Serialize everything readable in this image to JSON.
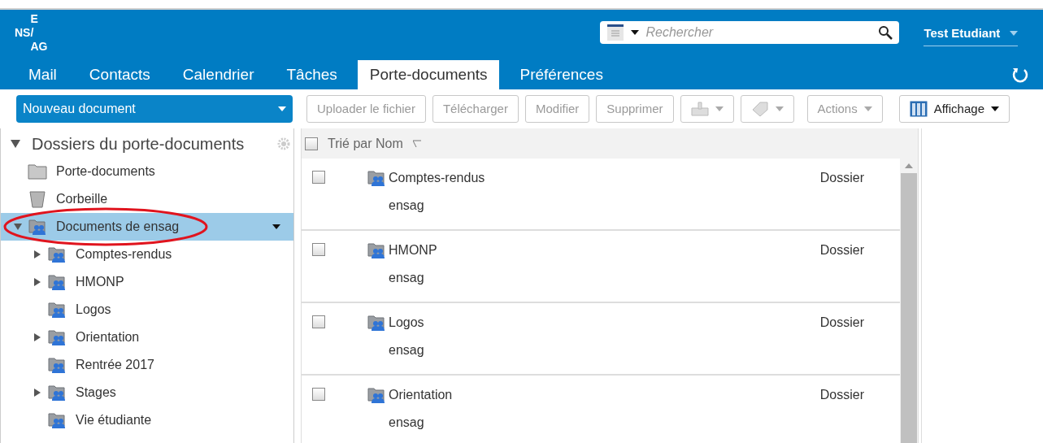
{
  "logo": [
    "E",
    "NS/",
    "AG"
  ],
  "search": {
    "placeholder": "Rechercher"
  },
  "user": {
    "name": "Test Etudiant"
  },
  "tabs": [
    {
      "label": "Mail",
      "selected": false
    },
    {
      "label": "Contacts",
      "selected": false
    },
    {
      "label": "Calendrier",
      "selected": false
    },
    {
      "label": "Tâches",
      "selected": false
    },
    {
      "label": "Porte-documents",
      "selected": true
    },
    {
      "label": "Préférences",
      "selected": false
    }
  ],
  "new_button": {
    "label": "Nouveau document"
  },
  "toolbar": [
    {
      "kind": "text",
      "label": "Uploader le fichier",
      "disabled": true
    },
    {
      "kind": "text",
      "label": "Télécharger",
      "disabled": true
    },
    {
      "kind": "text",
      "label": "Modifier",
      "disabled": true
    },
    {
      "kind": "text",
      "label": "Supprimer",
      "disabled": true
    },
    {
      "kind": "tray",
      "disabled": true
    },
    {
      "kind": "tag",
      "disabled": true
    },
    {
      "kind": "menu",
      "label": "Actions",
      "disabled": true
    },
    {
      "kind": "view",
      "label": "Affichage",
      "disabled": false
    }
  ],
  "sidebar": {
    "title": "Dossiers du porte-documents",
    "expanded": true,
    "items": [
      {
        "kind": "folder",
        "label": "Porte-documents",
        "selected": false
      },
      {
        "kind": "trash",
        "label": "Corbeille",
        "selected": false
      },
      {
        "kind": "shared",
        "label": "Documents de ensag",
        "selected": true,
        "expanded": true,
        "highlighted": true,
        "children": [
          {
            "kind": "shared",
            "label": "Comptes-rendus",
            "selected": false,
            "expandable": true
          },
          {
            "kind": "shared",
            "label": "HMONP",
            "selected": false,
            "expandable": true
          },
          {
            "kind": "shared",
            "label": "Logos",
            "selected": false,
            "expandable": false
          },
          {
            "kind": "shared",
            "label": "Orientation",
            "selected": false,
            "expandable": true
          },
          {
            "kind": "shared",
            "label": "Rentrée 2017",
            "selected": false,
            "expandable": false
          },
          {
            "kind": "shared",
            "label": "Stages",
            "selected": false,
            "expandable": true
          },
          {
            "kind": "shared",
            "label": "Vie étudiante",
            "selected": false,
            "expandable": false
          }
        ]
      }
    ]
  },
  "list": {
    "sort_label": "Trié par Nom",
    "all_checked": false,
    "rows": [
      {
        "name": "Comptes-rendus",
        "owner": "ensag",
        "type": "Dossier",
        "checked": false
      },
      {
        "name": "HMONP",
        "owner": "ensag",
        "type": "Dossier",
        "checked": false
      },
      {
        "name": "Logos",
        "owner": "ensag",
        "type": "Dossier",
        "checked": false
      },
      {
        "name": "Orientation",
        "owner": "ensag",
        "type": "Dossier",
        "checked": false
      }
    ]
  }
}
